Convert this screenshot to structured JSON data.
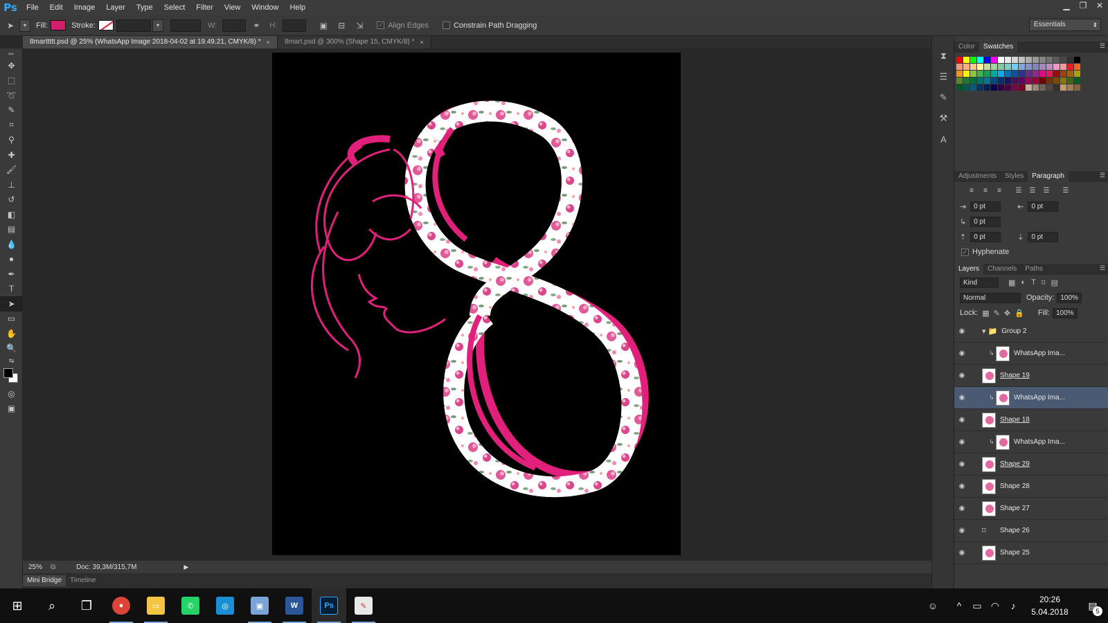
{
  "menubar": {
    "logo": "Ps",
    "items": [
      "File",
      "Edit",
      "Image",
      "Layer",
      "Type",
      "Select",
      "Filter",
      "View",
      "Window",
      "Help"
    ]
  },
  "options": {
    "fill_label": "Fill:",
    "stroke_label": "Stroke:",
    "w_label": "W:",
    "h_label": "H:",
    "align_edges": "Align Edges",
    "constrain": "Constrain Path Dragging",
    "workspace": "Essentials",
    "fill_color": "#d21f6c"
  },
  "tabs": [
    {
      "label": "8marttttt.psd @ 25% (WhatsApp Image 2018-04-02 at 19.49.21, CMYK/8) *",
      "active": true
    },
    {
      "label": "8mart.psd @ 300% (Shape 15, CMYK/8) *",
      "active": false
    }
  ],
  "status": {
    "zoom": "25%",
    "doc": "Doc: 39,3M/315,7M"
  },
  "bottom_tabs": [
    "Mini Bridge",
    "Timeline"
  ],
  "panels": {
    "color_tabs": [
      "Color",
      "Swatches"
    ],
    "adj_tabs": [
      "Adjustments",
      "Styles",
      "Paragraph"
    ],
    "para_values": [
      "0 pt",
      "0 pt",
      "0 pt",
      "0 pt",
      "0 pt"
    ],
    "hyphenate": "Hyphenate",
    "layer_tabs": [
      "Layers",
      "Channels",
      "Paths"
    ],
    "kind": "Kind",
    "blend_mode": "Normal",
    "opacity_label": "Opacity:",
    "opacity": "100%",
    "lock_label": "Lock:",
    "fill_label": "Fill:",
    "fill": "100%"
  },
  "layers": [
    {
      "name": "Group 2",
      "type": "group",
      "selected": false,
      "underline": false
    },
    {
      "name": "WhatsApp Ima...",
      "type": "clip",
      "selected": false,
      "underline": false
    },
    {
      "name": "Shape 19",
      "type": "shape",
      "selected": false,
      "underline": true
    },
    {
      "name": "WhatsApp Ima...",
      "type": "clip",
      "selected": true,
      "underline": false
    },
    {
      "name": "Shape 18",
      "type": "shape",
      "selected": false,
      "underline": true
    },
    {
      "name": "WhatsApp Ima...",
      "type": "clip",
      "selected": false,
      "underline": false
    },
    {
      "name": "Shape 29",
      "type": "shape",
      "selected": false,
      "underline": true
    },
    {
      "name": "Shape 28",
      "type": "shape",
      "selected": false,
      "underline": false
    },
    {
      "name": "Shape 27",
      "type": "shape",
      "selected": false,
      "underline": false
    },
    {
      "name": "Shape 26",
      "type": "path",
      "selected": false,
      "underline": false
    },
    {
      "name": "Shape 25",
      "type": "shape",
      "selected": false,
      "underline": false
    }
  ],
  "taskbar": {
    "time": "20:26",
    "date": "5.04.2018",
    "notifications": "5",
    "apps": [
      "start-icon",
      "search-icon",
      "task-view-icon",
      "chrome-icon",
      "file-explorer-icon",
      "whatsapp-icon",
      "instagram-icon",
      "photos-icon",
      "word-icon",
      "photoshop-icon",
      "paint-icon"
    ]
  },
  "swatch_colors": [
    "#ff0000",
    "#ffff00",
    "#00ff00",
    "#00ffff",
    "#0000ff",
    "#ff00ff",
    "#ffffff",
    "#ebebeb",
    "#d6d6d6",
    "#c2c2c2",
    "#adadad",
    "#999999",
    "#858585",
    "#707070",
    "#5c5c5c",
    "#474747",
    "#333333",
    "#000000",
    "#f7977a",
    "#f9ad81",
    "#fdc68a",
    "#fff79a",
    "#c4df9b",
    "#a2d39c",
    "#82ca9d",
    "#7bcdc8",
    "#6ecff6",
    "#7ea7d8",
    "#8493ca",
    "#8882be",
    "#a187be",
    "#bc8dbf",
    "#f49ac2",
    "#f6989d",
    "#ed1c24",
    "#f26522",
    "#f7941d",
    "#fff200",
    "#8dc73f",
    "#39b54a",
    "#00a651",
    "#00a99d",
    "#00aeef",
    "#0072bc",
    "#0054a6",
    "#2e3192",
    "#662d91",
    "#92278f",
    "#ec008c",
    "#ed145b",
    "#9e0b0f",
    "#a0410d",
    "#a36209",
    "#aba000",
    "#598527",
    "#197b30",
    "#007236",
    "#00746b",
    "#0076a3",
    "#004b80",
    "#003471",
    "#1b1464",
    "#440e62",
    "#630460",
    "#9e005d",
    "#9e0039",
    "#790000",
    "#7b2e00",
    "#7d4900",
    "#827b00",
    "#406618",
    "#005e20",
    "#005826",
    "#005952",
    "#005b7f",
    "#003663",
    "#002157",
    "#0d004c",
    "#32004b",
    "#4b0049",
    "#7b0046",
    "#7a0026",
    "#c7b299",
    "#998675",
    "#736357",
    "#534741",
    "#37302d",
    "#c69c6d",
    "#a67c52",
    "#8c6239"
  ]
}
